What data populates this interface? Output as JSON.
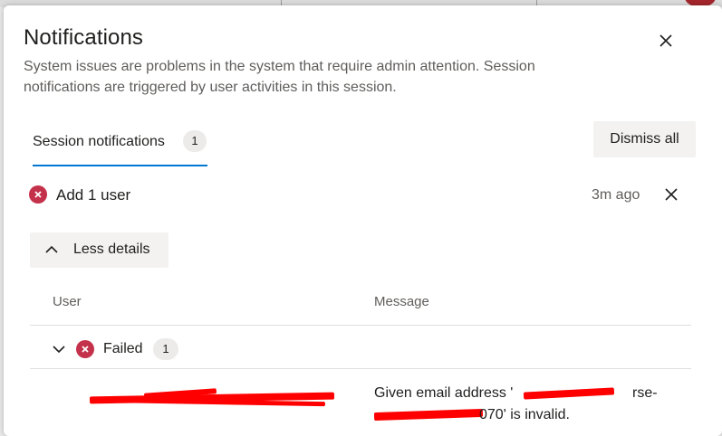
{
  "dialog": {
    "title": "Notifications",
    "description": "System issues are problems in the system that require admin attention. Session notifications are triggered by user activities in this session.",
    "close_icon": "close-icon"
  },
  "tabs": [
    {
      "label": "Session notifications",
      "count": "1",
      "selected": true
    }
  ],
  "actions": {
    "dismiss_all": "Dismiss all"
  },
  "notification": {
    "title": "Add 1 user",
    "time": "3m ago",
    "status_icon": "error-icon",
    "details_toggle": "Less details"
  },
  "table": {
    "columns": {
      "user": "User",
      "message": "Message"
    },
    "groups": [
      {
        "label": "Failed",
        "count": "1",
        "rows": [
          {
            "user": "…",
            "message_line1": "Given email address '",
            "message_line1_end": "rse-",
            "message_line2_end": "070' is invalid."
          }
        ]
      }
    ]
  },
  "colors": {
    "accent": "#0078d4",
    "error": "#c4314b",
    "redaction": "#ff0000"
  }
}
